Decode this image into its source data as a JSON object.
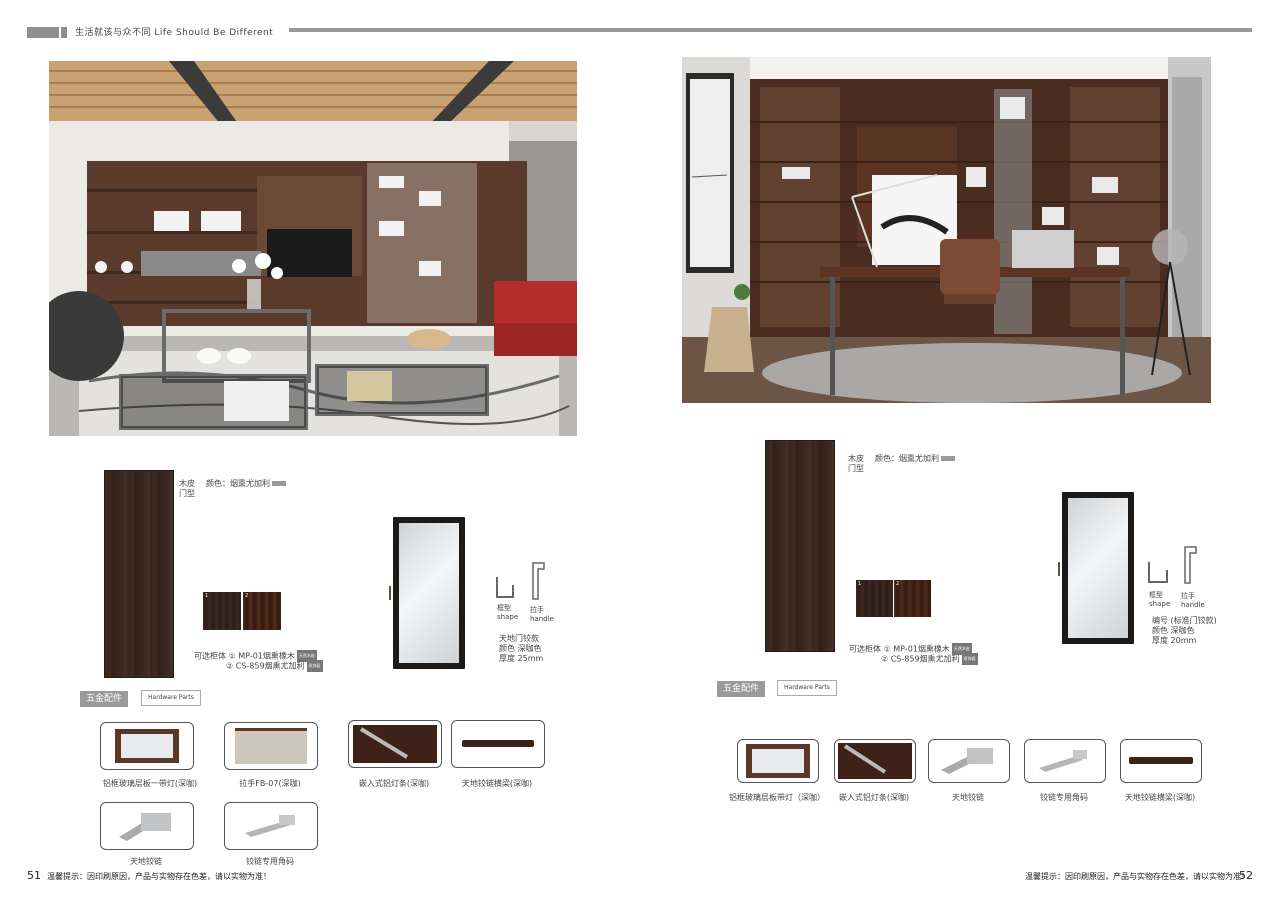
{
  "header": {
    "title": "生活就该与众不同 Life Should Be Different"
  },
  "left": {
    "door": {
      "material": "木皮",
      "type_label": "门型",
      "color": "颜色：烟熏尤加利",
      "color_tag": ""
    },
    "cabinet": {
      "title": "可选柜体 ①  MP-01烟熏橡木",
      "tag1": "天然木皮",
      "line2": "② CS-859烟熏尤加利",
      "tag2": "双饰面",
      "sw1": "1",
      "sw2": "2"
    },
    "frame": {
      "shape": "框型",
      "shape_en": "shape",
      "handle": "拉手",
      "handle_en": "handle",
      "line1": "天地门铰款",
      "line2": "颜色  深咖色",
      "line3": "厚度  25mm"
    },
    "hardware": {
      "label": "五金配件",
      "sub": "Hardware Parts",
      "items": [
        "铝框玻璃层板一带灯(深咖)",
        "拉手FB-07(深咖)",
        "嵌入式铝灯条(深咖)",
        "天地铰链横梁(深咖)",
        "天地铰链",
        "铰链专用角码"
      ]
    },
    "page": "51",
    "notice": "温馨提示：因印刷原因，产品与实物存在色差，请以实物为准！"
  },
  "right": {
    "door": {
      "material": "木皮",
      "type_label": "门型",
      "color": "颜色：烟熏尤加利",
      "color_tag": ""
    },
    "cabinet": {
      "title": "可选柜体 ①  MP-01烟熏橡木",
      "tag1": "天然木皮",
      "line2": "② CS-859烟熏尤加利",
      "tag2": "双饰面",
      "sw1": "1",
      "sw2": "2"
    },
    "frame": {
      "shape": "框型",
      "shape_en": "shape",
      "handle": "拉手",
      "handle_en": "handle",
      "line1": "编号  (标准门铰款)",
      "line2": "颜色  深咖色",
      "line3": "厚度  20mm"
    },
    "hardware": {
      "label": "五金配件",
      "sub": "Hardware Parts",
      "items": [
        "铝框玻璃层板带灯（深咖）",
        "嵌入式铝灯条(深咖)",
        "天地铰链",
        "铰链专用角码",
        "天地铰链横梁(深咖)"
      ]
    },
    "page": "52",
    "notice": "温馨提示：因印刷原因，产品与实物存在色差，请以实物为准！"
  }
}
